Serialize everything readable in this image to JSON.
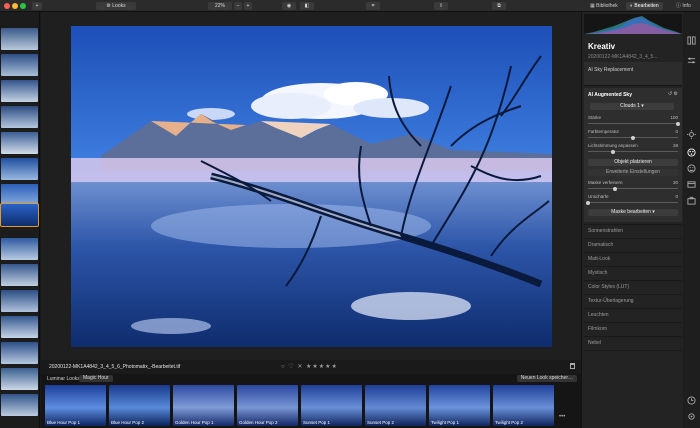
{
  "toolbar": {
    "add_label": "+",
    "looks_label": "Looks",
    "zoom_label": "22%",
    "zoom_minus": "–",
    "zoom_plus": "+",
    "tab_library": "Bibliothek",
    "tab_edit": "Bearbeiten",
    "tab_info": "Info"
  },
  "photo": {
    "filename": "20200122-MK1A4842_3_4_5_6_Photomatix_-Bearbeitet.tif",
    "rating_icons": "○ ♡  ✕ ★★★★★"
  },
  "looks": {
    "label": "Luminar Looks:",
    "category": "Magic Hour",
    "save_label": "Neuen Look speicher…",
    "items": [
      {
        "name": "Blue Hour Pop 1"
      },
      {
        "name": "Blue Hour Pop 2"
      },
      {
        "name": "Golden Hour Pop 1"
      },
      {
        "name": "Golden Hour Pop 2"
      },
      {
        "name": "Sunset Pop 1"
      },
      {
        "name": "Sunset Pop 2"
      },
      {
        "name": "Twilight Pop 1"
      },
      {
        "name": "Twilight Pop 2"
      }
    ]
  },
  "panel": {
    "title": "Kreativ",
    "file": "20200122-MK1A4842_3_4_5...",
    "ai_sky_replacement": "AI Sky Replacement",
    "ai_augmented": {
      "title": "AI Augmented Sky",
      "icons": "↺ ⚙",
      "sky_select": "Clouds 1 ▾",
      "sliders": [
        {
          "label": "Stärke",
          "value": "100",
          "fraction": 1.0
        },
        {
          "label": "Farbtemperatur",
          "value": "0",
          "fraction": 0.5
        },
        {
          "label": "Lichtstimmung anpassen",
          "value": "28",
          "fraction": 0.28
        }
      ],
      "place_button": "Objekt platzieren",
      "advanced_button": "Erweiterte Einstellungen",
      "mask_sliders": [
        {
          "label": "Maske verfeinern",
          "value": "30",
          "fraction": 0.3
        },
        {
          "label": "Unschärfe",
          "value": "0",
          "fraction": 0.0
        }
      ],
      "edit_mask_button": "Maske bearbeiten ▾"
    },
    "items": [
      "Sonnenstrahlen",
      "Dramatisch",
      "Matt-Look",
      "Mystisch",
      "Color Styles (LUT)",
      "Textur-Überlagerung",
      "Leuchten",
      "Filmkorn",
      "Nebel"
    ]
  },
  "colors": {
    "accent_selection": "#e59a1b",
    "sky_blue": "#2a5fc4",
    "panel_bg": "#232323"
  }
}
